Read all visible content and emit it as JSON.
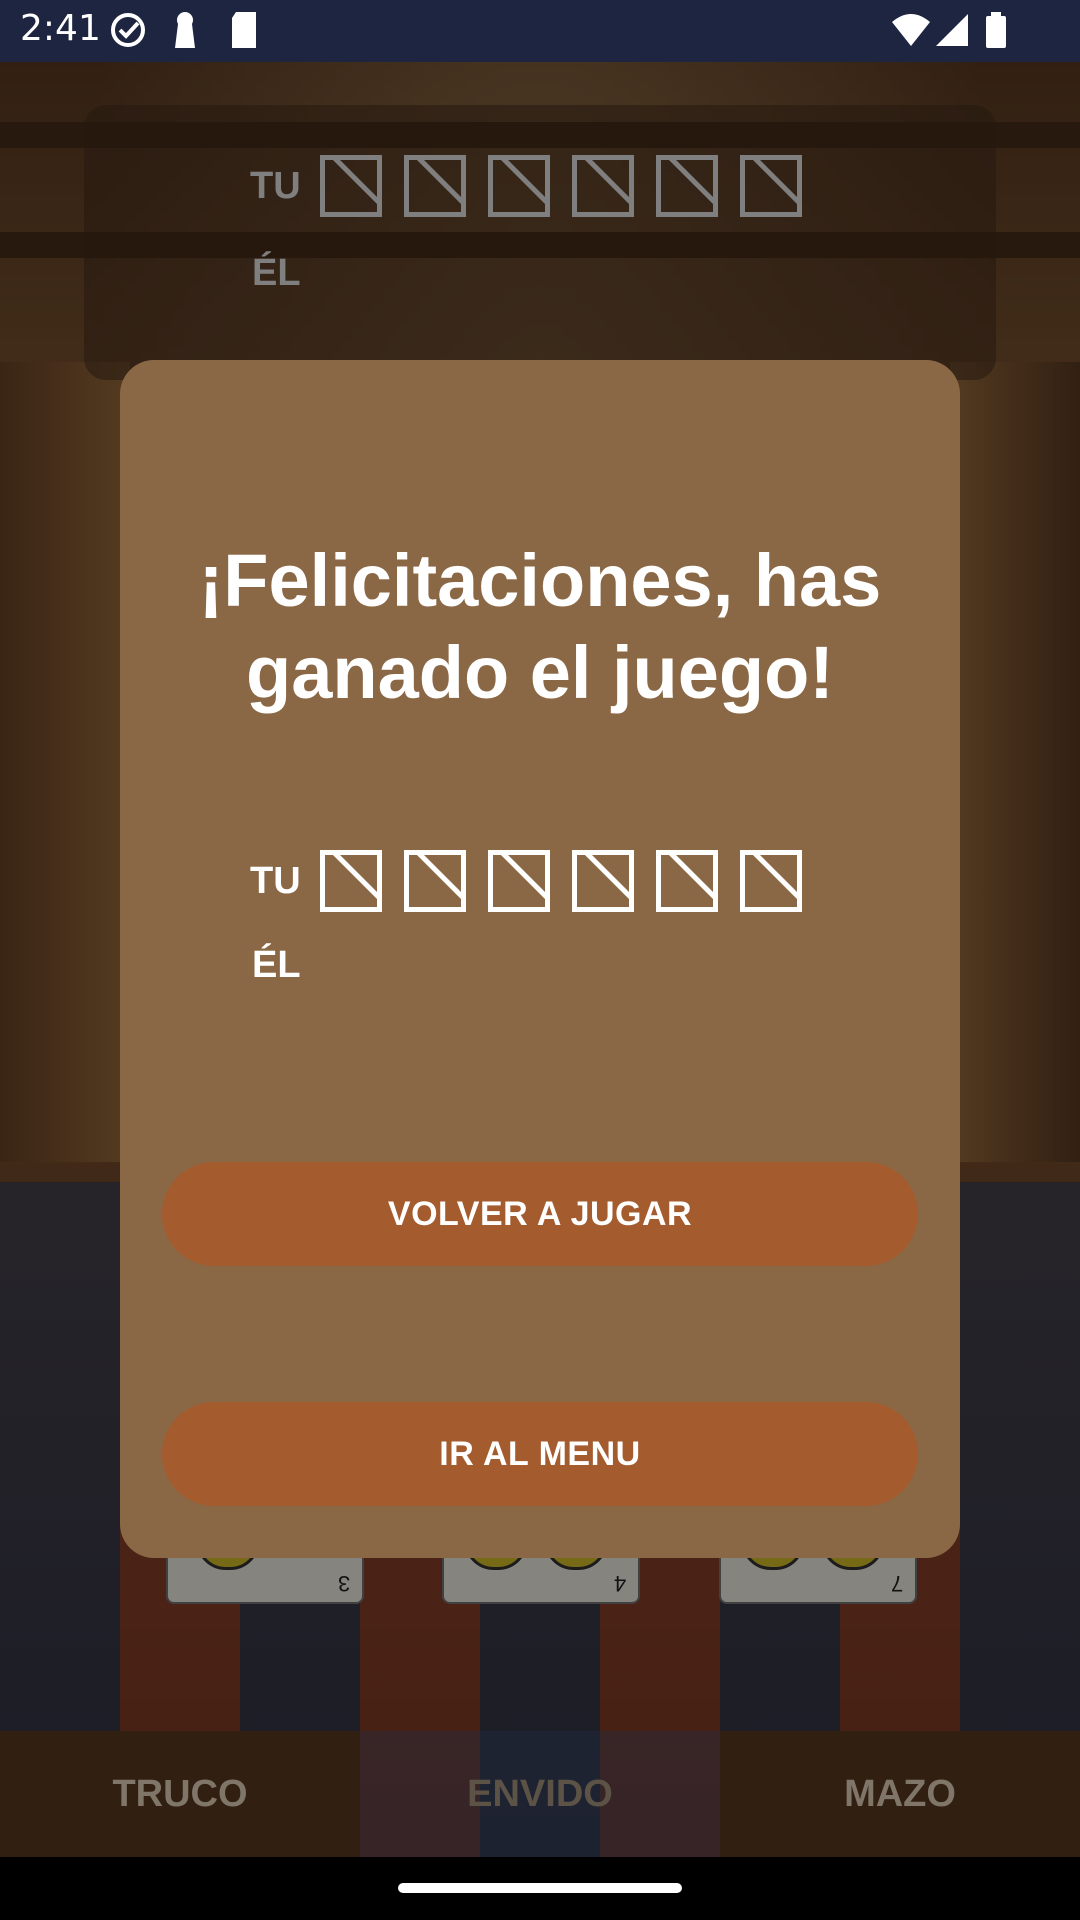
{
  "status_bar": {
    "time": "2:41",
    "icons": [
      "check-circle-icon",
      "keyhole-icon",
      "sd-card-icon",
      "wifi-icon",
      "signal-icon",
      "battery-icon"
    ]
  },
  "scoreboard_background": {
    "player_label": "TU",
    "opponent_label": "ÉL",
    "player_tally_boxes": 6,
    "opponent_tally_boxes": 0
  },
  "dialog": {
    "title": "¡Felicitaciones, has ganado el juego!",
    "scoreboard": {
      "player_label": "TU",
      "opponent_label": "ÉL",
      "player_tally_boxes": 6,
      "opponent_tally_boxes": 0
    },
    "play_again_label": "VOLVER A JUGAR",
    "menu_label": "IR AL MENU"
  },
  "cards": [
    {
      "number": "3"
    },
    {
      "number": "4"
    },
    {
      "number": "7"
    }
  ],
  "action_bar": {
    "truco_label": "TRUCO",
    "envido_label": "ENVIDO",
    "mazo_label": "MAZO"
  },
  "colors": {
    "dialog_bg": "#8b6845",
    "button_bg": "#a45b2e",
    "status_bar_bg": "#1d2540"
  }
}
